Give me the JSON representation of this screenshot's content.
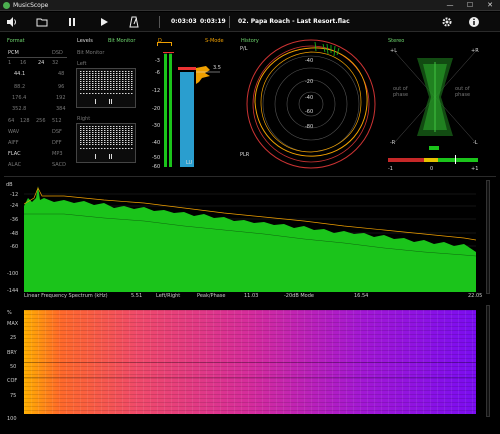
{
  "window": {
    "title": "MusicScope",
    "minimize": "—",
    "maximize": "☐",
    "close": "✕"
  },
  "toolbar": {
    "volume_icon": "speaker-icon",
    "open_icon": "folder-icon",
    "pause_icon": "pause-icon",
    "play_icon": "play-icon",
    "metronome_icon": "metronome-icon",
    "position": "0:03:03",
    "duration": "0:03:19",
    "track": "02. Papa Roach - Last Resort.flac",
    "settings_icon": "gear-icon",
    "info_icon": "info-icon"
  },
  "format": {
    "title": "Format",
    "pcm": "PCM",
    "dsd": "DSD",
    "bits": [
      "1",
      "16",
      "24",
      "32"
    ],
    "rates_left": [
      "44.1",
      "88.2",
      "176.4",
      "352.8"
    ],
    "rates_right": [
      "48",
      "96",
      "192",
      "384"
    ],
    "dsd_rates": [
      "64",
      "128",
      "256",
      "512"
    ],
    "containers_left": [
      "WAV",
      "AIFF",
      "FLAC",
      "ALAC"
    ],
    "containers_right": [
      "DSF",
      "DFF",
      "MP3",
      "SACD"
    ]
  },
  "levels": {
    "title": "Levels",
    "bit_monitor": "Bit Monitor",
    "bit_monitor2": "Bit Monitor",
    "left": "Left",
    "right": "Right"
  },
  "meter": {
    "d_label": "D",
    "mode_label": "S-Mode",
    "scale": [
      "-3",
      "-6",
      "-12",
      "-20",
      "-30",
      "-40",
      "-50",
      "-60"
    ],
    "value": "3.5",
    "readout_left": "",
    "readout_right": "LU"
  },
  "history": {
    "title": "History",
    "pl_label": "P/L",
    "plr_label": "PLR",
    "rings": [
      "-40",
      "-20",
      "-40",
      "-60",
      "-80"
    ]
  },
  "stereo": {
    "title": "Stereo",
    "plus_l": "+L",
    "plus_r": "+R",
    "minus_l": "-R",
    "minus_r": "-L",
    "phase_out": "out of phase",
    "phase_out2": "out of phase",
    "scale_min": "-1",
    "scale_mid": "0",
    "scale_max": "+1"
  },
  "spectrum": {
    "db_label": "dB",
    "y_ticks": [
      "-12",
      "-24",
      "-36",
      "-48",
      "-60",
      "-100",
      "-144"
    ],
    "caption": "Linear Frequency Spectrum (kHz)",
    "left_right": "Left/Right",
    "peak_phase": "Peak/Phase",
    "mode": "-20dB Mode",
    "x_ticks": [
      "5.51",
      "11.03",
      "16.54",
      "22.05"
    ]
  },
  "spectrogram": {
    "pct_label": "%",
    "max_label": "MAX",
    "y_ticks": [
      "25",
      "50",
      "75",
      "100"
    ],
    "bright_label": "BRY",
    "cof_label": "COF"
  },
  "colors": {
    "accent_green": "#6fd86f",
    "accent_orange": "#f0a000",
    "spectrum_green": "#1bc41b",
    "meter_blue": "#2a9ecf"
  }
}
